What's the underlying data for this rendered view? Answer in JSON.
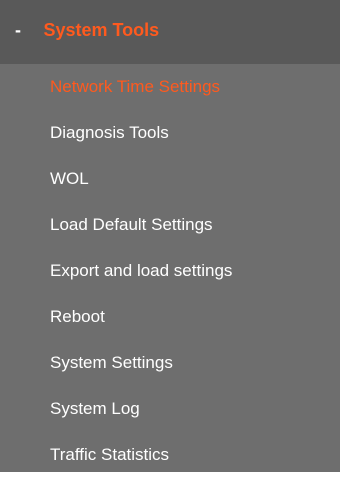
{
  "menu": {
    "toggle_symbol": "-",
    "title": "System Tools",
    "items": [
      {
        "label": "Network Time Settings",
        "active": true
      },
      {
        "label": "Diagnosis Tools",
        "active": false
      },
      {
        "label": "WOL",
        "active": false
      },
      {
        "label": "Load Default Settings",
        "active": false
      },
      {
        "label": "Export and load settings",
        "active": false
      },
      {
        "label": "Reboot",
        "active": false
      },
      {
        "label": "System Settings",
        "active": false
      },
      {
        "label": "System Log",
        "active": false
      },
      {
        "label": "Traffic Statistics",
        "active": false
      }
    ]
  },
  "colors": {
    "background": "#6e6e6e",
    "header_background": "#595959",
    "accent": "#ff5a1e",
    "text": "#ffffff"
  }
}
